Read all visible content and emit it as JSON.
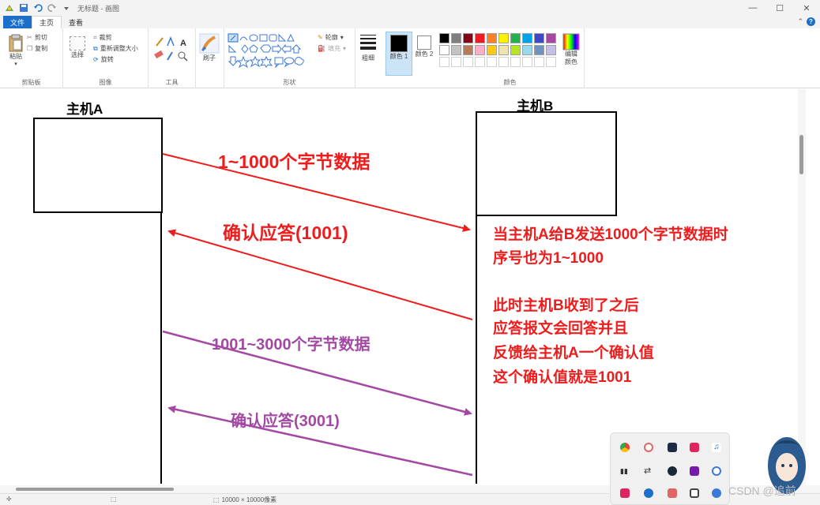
{
  "window": {
    "title": "无标题 - 画图",
    "controls": [
      "—",
      "☐",
      "✕"
    ]
  },
  "tabs": [
    {
      "label": "文件"
    },
    {
      "label": "主页"
    },
    {
      "label": "查看"
    }
  ],
  "ribbon": {
    "clipboard": {
      "label": "剪贴板",
      "paste": "粘贴",
      "cut": "剪切",
      "copy": "复制"
    },
    "image": {
      "label": "图像",
      "select": "选择",
      "crop": "裁剪",
      "resize": "重新调整大小",
      "rotate": "旋转"
    },
    "tools": {
      "label": "工具"
    },
    "brushes": {
      "label": "刷子"
    },
    "shapes": {
      "label": "形状",
      "outline": "轮廓",
      "fill": "填充"
    },
    "size": {
      "label": "粗细"
    },
    "color1": {
      "label": "颜色 1"
    },
    "color2": {
      "label": "颜色 2"
    },
    "colors": {
      "label": "颜色",
      "edit": "编辑颜色"
    },
    "palette_row1": [
      "#000000",
      "#7f7f7f",
      "#880015",
      "#ed1c24",
      "#ff7f27",
      "#fff200",
      "#22b14c",
      "#00a2e8",
      "#3f48cc",
      "#a349a4"
    ],
    "palette_row2": [
      "#ffffff",
      "#c3c3c3",
      "#b97a57",
      "#ffaec9",
      "#ffc90e",
      "#efe4b0",
      "#b5e61d",
      "#99d9ea",
      "#7092be",
      "#c8bfe7"
    ]
  },
  "diagram": {
    "host_a": "主机A",
    "host_b": "主机B",
    "msg1": "1~1000个字节数据",
    "ack1": "确认应答(1001)",
    "msg2": "1001~3000个字节数据",
    "ack2": "确认应答(3001)",
    "note": [
      "当主机A给B发送1000个字节数据时",
      "序号也为1~1000",
      "此时主机B收到了之后",
      "应答报文会回答并且",
      "反馈给主机A一个确认值",
      "这个确认值就是1001"
    ],
    "colors": {
      "red": "#ee1c1c",
      "purple": "#a349a4"
    }
  },
  "statusbar": {
    "size": "10000 × 10000像素"
  },
  "watermark": "CSDN @追前"
}
